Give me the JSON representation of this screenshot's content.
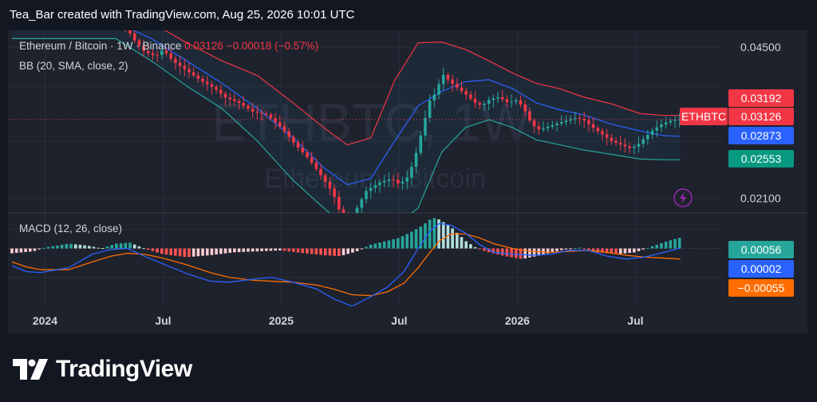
{
  "header": {
    "text": "Tea_Bar created with TradingView.com, Aug 25, 2026 10:01 UTC"
  },
  "legend": {
    "symbol": "Ethereum / Bitcoin · 1W · Binance",
    "price": "0.03126",
    "change": "−0.00018 (−0.57%)",
    "bb": "BB (20, SMA, close, 2)",
    "macd": "MACD (12, 26, close)"
  },
  "watermark": {
    "ticker": "ETHBTC, 1W",
    "name": "Ethereum / Bitcoin"
  },
  "footer": {
    "brand": "TradingView"
  },
  "colors": {
    "up": "#26a69a",
    "down": "#f23645",
    "upper_band": "#f23645",
    "basis": "#2962ff",
    "lower_band": "#26a69a",
    "macd_line": "#2962ff",
    "signal_line": "#ff6d00",
    "background": "#1e222d",
    "page": "#131722"
  },
  "chart_data": [
    {
      "type": "candlestick",
      "title": "Ethereum / Bitcoin · 1W · Binance",
      "scale": "log",
      "ylim": [
        0.0195,
        0.049
      ],
      "y_ticks": [
        "0.04500",
        "0.02100"
      ],
      "y_tick_values": [
        0.045,
        0.021
      ],
      "x_ticks": [
        {
          "label": "2024",
          "t": 2024.0
        },
        {
          "label": "Jul",
          "t": 2024.5
        },
        {
          "label": "2025",
          "t": 2025.0
        },
        {
          "label": "Jul",
          "t": 2025.5
        },
        {
          "label": "2026",
          "t": 2026.0
        },
        {
          "label": "Jul",
          "t": 2026.5
        }
      ],
      "xlim": [
        2023.86,
        2026.85
      ],
      "bb_series": [
        {
          "t": 2023.86,
          "upper": 0.053,
          "basis": 0.05,
          "lower": 0.047
        },
        {
          "t": 2024.3,
          "upper": 0.056,
          "basis": 0.051,
          "lower": 0.047
        },
        {
          "t": 2024.45,
          "upper": 0.051,
          "basis": 0.047,
          "lower": 0.042
        },
        {
          "t": 2024.6,
          "upper": 0.046,
          "basis": 0.042,
          "lower": 0.037
        },
        {
          "t": 2024.75,
          "upper": 0.042,
          "basis": 0.0375,
          "lower": 0.033
        },
        {
          "t": 2024.9,
          "upper": 0.039,
          "basis": 0.033,
          "lower": 0.028
        },
        {
          "t": 2025.05,
          "upper": 0.034,
          "basis": 0.0285,
          "lower": 0.023
        },
        {
          "t": 2025.18,
          "upper": 0.03,
          "basis": 0.0245,
          "lower": 0.02
        },
        {
          "t": 2025.28,
          "upper": 0.0275,
          "basis": 0.0225,
          "lower": 0.018
        },
        {
          "t": 2025.38,
          "upper": 0.0285,
          "basis": 0.0232,
          "lower": 0.0182
        },
        {
          "t": 2025.48,
          "upper": 0.038,
          "basis": 0.028,
          "lower": 0.0182
        },
        {
          "t": 2025.58,
          "upper": 0.046,
          "basis": 0.0335,
          "lower": 0.02
        },
        {
          "t": 2025.68,
          "upper": 0.0462,
          "basis": 0.036,
          "lower": 0.0265
        },
        {
          "t": 2025.78,
          "upper": 0.0445,
          "basis": 0.0378,
          "lower": 0.03
        },
        {
          "t": 2025.88,
          "upper": 0.042,
          "basis": 0.0382,
          "lower": 0.0312
        },
        {
          "t": 2025.98,
          "upper": 0.0395,
          "basis": 0.0365,
          "lower": 0.03
        },
        {
          "t": 2026.08,
          "upper": 0.0375,
          "basis": 0.034,
          "lower": 0.0282
        },
        {
          "t": 2026.18,
          "upper": 0.0365,
          "basis": 0.0328,
          "lower": 0.0275
        },
        {
          "t": 2026.28,
          "upper": 0.035,
          "basis": 0.032,
          "lower": 0.0268
        },
        {
          "t": 2026.4,
          "upper": 0.0338,
          "basis": 0.0305,
          "lower": 0.0262
        },
        {
          "t": 2026.52,
          "upper": 0.0322,
          "basis": 0.0295,
          "lower": 0.0256
        },
        {
          "t": 2026.62,
          "upper": 0.0319,
          "basis": 0.0288,
          "lower": 0.0255
        },
        {
          "t": 2026.69,
          "upper": 0.0319,
          "basis": 0.0287,
          "lower": 0.0255
        }
      ],
      "price_path": [
        [
          2023.86,
          0.056
        ],
        [
          2023.96,
          0.058
        ],
        [
          2024.1,
          0.0555
        ],
        [
          2024.24,
          0.052
        ],
        [
          2024.3,
          0.0555
        ],
        [
          2024.34,
          0.05
        ],
        [
          2024.38,
          0.0465
        ],
        [
          2024.42,
          0.044
        ],
        [
          2024.47,
          0.043
        ],
        [
          2024.5,
          0.0445
        ],
        [
          2024.54,
          0.042
        ],
        [
          2024.6,
          0.04
        ],
        [
          2024.66,
          0.038
        ],
        [
          2024.72,
          0.0365
        ],
        [
          2024.76,
          0.035
        ],
        [
          2024.82,
          0.034
        ],
        [
          2024.88,
          0.0325
        ],
        [
          2024.94,
          0.032
        ],
        [
          2025.0,
          0.03
        ],
        [
          2025.06,
          0.0275
        ],
        [
          2025.12,
          0.0255
        ],
        [
          2025.17,
          0.0235
        ],
        [
          2025.22,
          0.0215
        ],
        [
          2025.25,
          0.0195
        ],
        [
          2025.3,
          0.019
        ],
        [
          2025.36,
          0.0218
        ],
        [
          2025.42,
          0.0228
        ],
        [
          2025.47,
          0.0232
        ],
        [
          2025.5,
          0.0225
        ],
        [
          2025.54,
          0.0235
        ],
        [
          2025.57,
          0.0262
        ],
        [
          2025.6,
          0.03
        ],
        [
          2025.63,
          0.0345
        ],
        [
          2025.66,
          0.036
        ],
        [
          2025.68,
          0.0395
        ],
        [
          2025.7,
          0.0385
        ],
        [
          2025.73,
          0.0372
        ],
        [
          2025.76,
          0.0362
        ],
        [
          2025.79,
          0.0352
        ],
        [
          2025.82,
          0.034
        ],
        [
          2025.85,
          0.0335
        ],
        [
          2025.88,
          0.0345
        ],
        [
          2025.92,
          0.035
        ],
        [
          2025.96,
          0.034
        ],
        [
          2026.0,
          0.0345
        ],
        [
          2026.03,
          0.0328
        ],
        [
          2026.06,
          0.0305
        ],
        [
          2026.09,
          0.0297
        ],
        [
          2026.12,
          0.03
        ],
        [
          2026.16,
          0.0305
        ],
        [
          2026.2,
          0.031
        ],
        [
          2026.24,
          0.0315
        ],
        [
          2026.28,
          0.0312
        ],
        [
          2026.32,
          0.03
        ],
        [
          2026.36,
          0.029
        ],
        [
          2026.4,
          0.028
        ],
        [
          2026.44,
          0.0275
        ],
        [
          2026.48,
          0.027
        ],
        [
          2026.51,
          0.0275
        ],
        [
          2026.54,
          0.0285
        ],
        [
          2026.57,
          0.0295
        ],
        [
          2026.6,
          0.0303
        ],
        [
          2026.63,
          0.0308
        ],
        [
          2026.66,
          0.0312
        ],
        [
          2026.69,
          0.03126
        ]
      ],
      "labels": [
        {
          "text": "0.03192",
          "value": 0.03192,
          "color": "#f23645"
        },
        {
          "text": "ETHBTC",
          "value": 0.03126,
          "color": "#f23645",
          "inside": true
        },
        {
          "text": "0.03126",
          "value": 0.03126,
          "color": "#f23645"
        },
        {
          "text": "0.02873",
          "value": 0.02873,
          "color": "#2962ff"
        },
        {
          "text": "0.02553",
          "value": 0.02553,
          "color": "#089981"
        }
      ],
      "last_price": 0.03126
    },
    {
      "type": "macd",
      "title": "MACD (12, 26, close)",
      "ylim": [
        -0.003,
        0.0018
      ],
      "histogram_path": [
        [
          2023.86,
          -0.00025
        ],
        [
          2023.95,
          -0.00015
        ],
        [
          2024.0,
          5e-05
        ],
        [
          2024.1,
          0.00025
        ],
        [
          2024.18,
          0.00015
        ],
        [
          2024.24,
          0.0
        ],
        [
          2024.3,
          0.00025
        ],
        [
          2024.36,
          0.0003
        ],
        [
          2024.42,
          0.0
        ],
        [
          2024.5,
          -0.0003
        ],
        [
          2024.6,
          -0.00045
        ],
        [
          2024.7,
          -0.00035
        ],
        [
          2024.8,
          -0.0002
        ],
        [
          2024.9,
          -0.00015
        ],
        [
          2025.0,
          -0.0001
        ],
        [
          2025.1,
          -0.00025
        ],
        [
          2025.18,
          -0.00035
        ],
        [
          2025.25,
          -0.0004
        ],
        [
          2025.32,
          -0.00015
        ],
        [
          2025.38,
          0.0002
        ],
        [
          2025.45,
          0.0004
        ],
        [
          2025.5,
          0.00055
        ],
        [
          2025.55,
          0.00085
        ],
        [
          2025.6,
          0.0012
        ],
        [
          2025.64,
          0.0016
        ],
        [
          2025.67,
          0.0015
        ],
        [
          2025.72,
          0.0011
        ],
        [
          2025.78,
          0.0004
        ],
        [
          2025.83,
          0.0
        ],
        [
          2025.88,
          -0.0002
        ],
        [
          2025.95,
          -0.0004
        ],
        [
          2026.02,
          -0.00055
        ],
        [
          2026.1,
          -0.00035
        ],
        [
          2026.18,
          -0.0001
        ],
        [
          2026.26,
          5e-05
        ],
        [
          2026.34,
          -0.0002
        ],
        [
          2026.42,
          -0.0003
        ],
        [
          2026.5,
          -0.0002
        ],
        [
          2026.58,
          0.00015
        ],
        [
          2026.64,
          0.0004
        ],
        [
          2026.69,
          0.00056
        ]
      ],
      "macd_line": [
        [
          2023.86,
          -0.0009
        ],
        [
          2023.92,
          -0.0012
        ],
        [
          2023.98,
          -0.00125
        ],
        [
          2024.1,
          -0.001
        ],
        [
          2024.2,
          -0.0003
        ],
        [
          2024.28,
          -5e-05
        ],
        [
          2024.35,
          0.0
        ],
        [
          2024.42,
          -0.0004
        ],
        [
          2024.5,
          -0.0008
        ],
        [
          2024.6,
          -0.0013
        ],
        [
          2024.7,
          -0.0017
        ],
        [
          2024.78,
          -0.00175
        ],
        [
          2024.88,
          -0.0016
        ],
        [
          2024.96,
          -0.0015
        ],
        [
          2025.05,
          -0.00175
        ],
        [
          2025.15,
          -0.0021
        ],
        [
          2025.22,
          -0.0026
        ],
        [
          2025.3,
          -0.003
        ],
        [
          2025.38,
          -0.0025
        ],
        [
          2025.45,
          -0.002
        ],
        [
          2025.52,
          -0.0012
        ],
        [
          2025.58,
          0.0
        ],
        [
          2025.63,
          0.0009
        ],
        [
          2025.67,
          0.0013
        ],
        [
          2025.72,
          0.0012
        ],
        [
          2025.78,
          0.0008
        ],
        [
          2025.84,
          0.0002
        ],
        [
          2025.9,
          -0.0002
        ],
        [
          2025.98,
          -0.0003
        ],
        [
          2026.06,
          -0.00035
        ],
        [
          2026.14,
          -0.0003
        ],
        [
          2026.22,
          -0.0001
        ],
        [
          2026.3,
          -0.0001
        ],
        [
          2026.38,
          -0.0004
        ],
        [
          2026.46,
          -0.00055
        ],
        [
          2026.54,
          -0.00045
        ],
        [
          2026.62,
          -0.0002
        ],
        [
          2026.69,
          2e-05
        ]
      ],
      "signal_line": [
        [
          2023.86,
          -0.0007
        ],
        [
          2023.92,
          -0.00095
        ],
        [
          2023.98,
          -0.0011
        ],
        [
          2024.1,
          -0.0011
        ],
        [
          2024.2,
          -0.0007
        ],
        [
          2024.28,
          -0.0004
        ],
        [
          2024.35,
          -0.00025
        ],
        [
          2024.42,
          -0.0003
        ],
        [
          2024.5,
          -0.0005
        ],
        [
          2024.6,
          -0.00085
        ],
        [
          2024.7,
          -0.00125
        ],
        [
          2024.78,
          -0.0015
        ],
        [
          2024.88,
          -0.00165
        ],
        [
          2024.96,
          -0.0017
        ],
        [
          2025.05,
          -0.00175
        ],
        [
          2025.15,
          -0.0019
        ],
        [
          2025.22,
          -0.0021
        ],
        [
          2025.3,
          -0.0024
        ],
        [
          2025.38,
          -0.00245
        ],
        [
          2025.45,
          -0.00225
        ],
        [
          2025.52,
          -0.0018
        ],
        [
          2025.58,
          -0.001
        ],
        [
          2025.63,
          -0.0002
        ],
        [
          2025.67,
          0.0004
        ],
        [
          2025.72,
          0.00075
        ],
        [
          2025.78,
          0.00075
        ],
        [
          2025.84,
          0.00055
        ],
        [
          2025.9,
          0.00025
        ],
        [
          2025.98,
          0.0
        ],
        [
          2026.06,
          -0.00015
        ],
        [
          2026.14,
          -0.0002
        ],
        [
          2026.22,
          -0.00015
        ],
        [
          2026.3,
          -0.0001
        ],
        [
          2026.38,
          -0.0002
        ],
        [
          2026.46,
          -0.00035
        ],
        [
          2026.54,
          -0.00045
        ],
        [
          2026.62,
          -0.0005
        ],
        [
          2026.69,
          -0.00055
        ]
      ],
      "labels": [
        {
          "text": "0.00056",
          "value": 0.00056,
          "color": "#26a69a"
        },
        {
          "text": "0.00002",
          "value": 2e-05,
          "color": "#2962ff"
        },
        {
          "text": "−0.00055",
          "value": -0.00055,
          "color": "#ff6d00"
        }
      ]
    }
  ]
}
